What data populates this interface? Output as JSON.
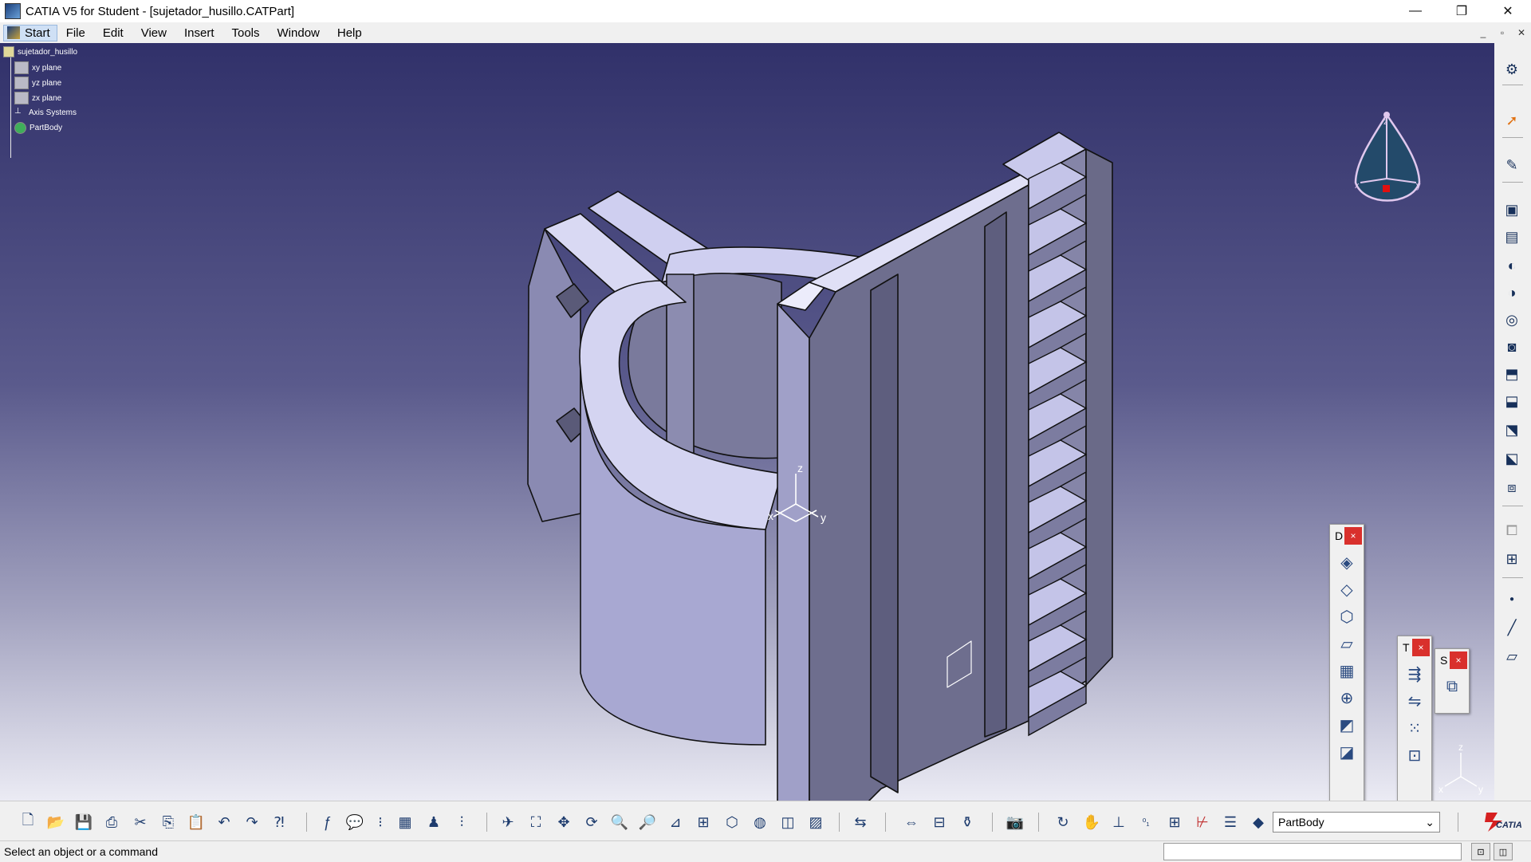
{
  "window": {
    "title": "CATIA V5 for Student - [sujetador_husillo.CATPart]",
    "minimize": "—",
    "maximize": "❐",
    "close": "✕"
  },
  "menu": {
    "start": "Start",
    "items": [
      "File",
      "Edit",
      "View",
      "Insert",
      "Tools",
      "Window",
      "Help"
    ],
    "mdi_minimize": "_",
    "mdi_restore": "▫",
    "mdi_close": "✕"
  },
  "spec_tree": {
    "root": "sujetador_husillo",
    "items": [
      "xy plane",
      "yz plane",
      "zx plane",
      "Axis Systems",
      "PartBody"
    ]
  },
  "axes": {
    "x": "x",
    "y": "y",
    "z": "z"
  },
  "floating_toolbars": [
    {
      "title": "D",
      "close": "×"
    },
    {
      "title": "T",
      "close": "×"
    },
    {
      "title": "S",
      "close": "×"
    }
  ],
  "current_body": "PartBody",
  "status": {
    "message": "Select an object or a command"
  },
  "brand": "CATIA",
  "colors": {
    "viewport_top": "#31316a",
    "viewport_bottom": "#ebebf4",
    "part_face_light": "#d4d4f1",
    "part_face_mid": "#a8a8d2",
    "part_face_dark": "#6c6c8a",
    "close_red": "#d9302c"
  }
}
